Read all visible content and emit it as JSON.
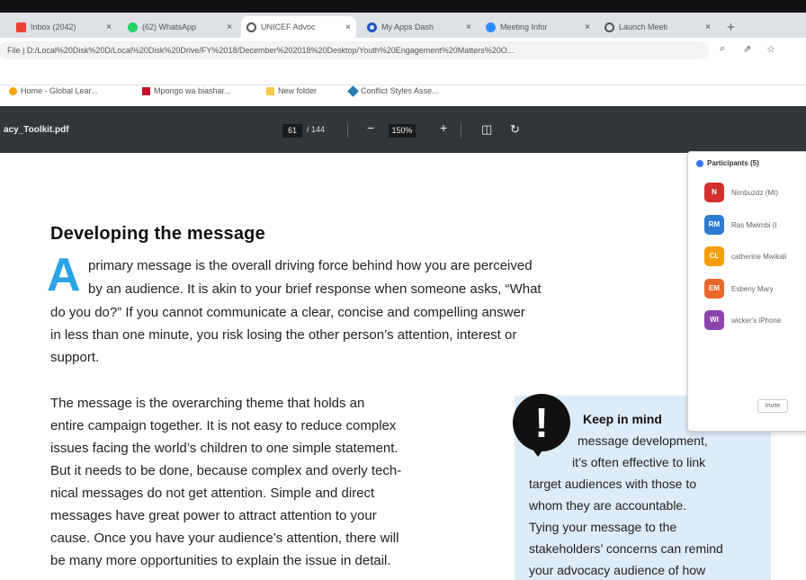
{
  "browser": {
    "tabs": [
      {
        "label": "Inbox (2042)",
        "color": "#ea4335",
        "active": false
      },
      {
        "label": "(62) WhatsApp",
        "color": "#25d366",
        "active": false
      },
      {
        "label": "UNICEF Advoc",
        "color": "#555555",
        "active": true
      },
      {
        "label": "My Apps Dash",
        "color": "#1a56c7",
        "active": false
      },
      {
        "label": "Meeting Infor",
        "color": "#2d8cff",
        "active": false
      },
      {
        "label": "Launch Meeti",
        "color": "#555555",
        "active": false
      }
    ],
    "new_tab": "+",
    "address": "File  |  D:/Local%20Disk%20D/Local%20Disk%20Drive/FY%2018/December%202018%20Desktop/Youth%20Engagement%20Matters%20O...",
    "bookmarks": [
      {
        "label": "Home - Global Lear...",
        "color": "#f4a300"
      },
      {
        "label": "Mpongo wa biashar...",
        "color": "#c8102e"
      },
      {
        "label": "New folder",
        "color": "#f7c948"
      },
      {
        "label": "Conflict Styles Asse...",
        "color": "#2a7ab0"
      }
    ]
  },
  "pdf": {
    "filename": "acy_Toolkit.pdf",
    "page_current": "61",
    "page_total": "/ 144",
    "zoom": "150%"
  },
  "document": {
    "heading": "Developing the message",
    "dropcap": "A",
    "para1": [
      "primary message is the overall driving force behind how you are perceived",
      "by an audience. It is akin to your brief response when someone asks, “What",
      "do you do?”  If you cannot communicate a clear, concise and compelling answer",
      "in less than one minute, you risk losing the other person’s attention, interest or",
      "support."
    ],
    "para2": [
      "The message is the overarching theme that holds an",
      "entire campaign together. It is not easy to reduce complex",
      "issues facing the world’s children to one simple statement.",
      "But it needs to be done, because complex and overly tech-",
      "nical messages do not get attention. Simple and direct",
      "messages have great power to attract attention to your",
      "cause. Once you have your audience’s attention, there will",
      "be many more opportunities to explain the issue in detail."
    ],
    "callout": {
      "icon": "!",
      "title": "Keep in mind",
      "lines": [
        "message development,",
        "it’s often effective to link",
        "target audiences with those to",
        "whom they are accountable.",
        "Tying your message to the",
        "stakeholders’ concerns can remind",
        "your advocacy audience of how"
      ]
    }
  },
  "participants": {
    "title": "Participants (5)",
    "people": [
      {
        "initials": "N",
        "name": "Nimbuzdz (Mt)",
        "color": "#d32f2f"
      },
      {
        "initials": "RM",
        "name": "Ras Mwimbi (I",
        "color": "#2e7bd1"
      },
      {
        "initials": "CL",
        "name": "catherine Mwikali",
        "color": "#f59e0b"
      },
      {
        "initials": "EM",
        "name": "Esbeny Mary",
        "color": "#e8682a"
      },
      {
        "initials": "WI",
        "name": "wicker's iPhone",
        "color": "#8e44ad"
      }
    ],
    "invite": "Invite"
  }
}
